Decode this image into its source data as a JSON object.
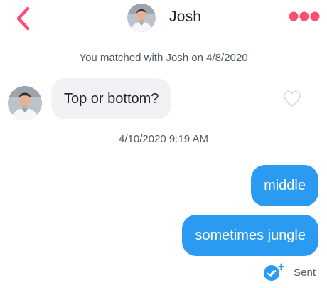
{
  "header": {
    "name": "Josh",
    "back_icon": "chevron-left-icon",
    "more_icon": "more-dots-icon",
    "accent_color": "#fd4d70"
  },
  "match_text": "You matched with Josh on 4/8/2020",
  "messages": [
    {
      "from": "Josh",
      "text": "Top or bottom?"
    },
    {
      "from": "me",
      "text": "middle"
    },
    {
      "from": "me",
      "text": "sometimes jungle"
    }
  ],
  "timestamp": "4/10/2020 9:19 AM",
  "status": {
    "label": "Sent",
    "icon": "sent-check-icon"
  },
  "colors": {
    "outgoing_bubble": "#2b9bf2",
    "incoming_bubble": "#f0f2f4"
  }
}
